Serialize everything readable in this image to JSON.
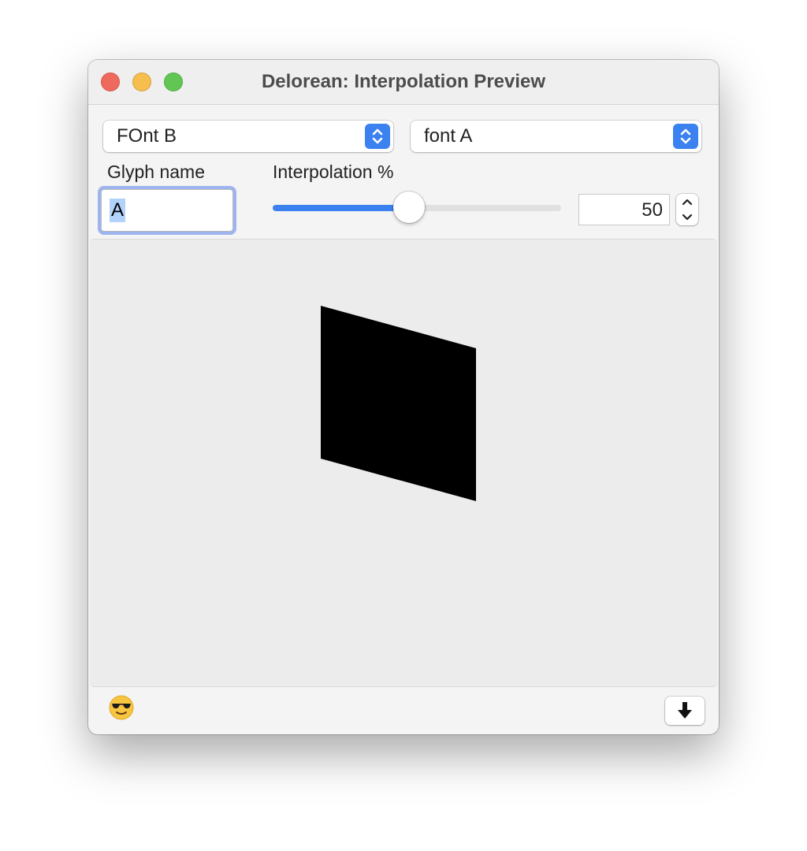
{
  "window": {
    "title": "Delorean: Interpolation Preview"
  },
  "fonts": {
    "left_popup": {
      "selected": "FOnt B"
    },
    "right_popup": {
      "selected": "font A"
    }
  },
  "glyph": {
    "label": "Glyph name",
    "value": "A"
  },
  "interpolation": {
    "label": "Interpolation %",
    "value": "50",
    "slider_fraction": 0.5
  },
  "colors": {
    "accent": "#3b82f0",
    "glyph_fill": "#000000",
    "preview_background": "#ececec"
  },
  "icons": {
    "status": "sunglasses-emoji-icon",
    "download": "download-arrow-icon"
  }
}
